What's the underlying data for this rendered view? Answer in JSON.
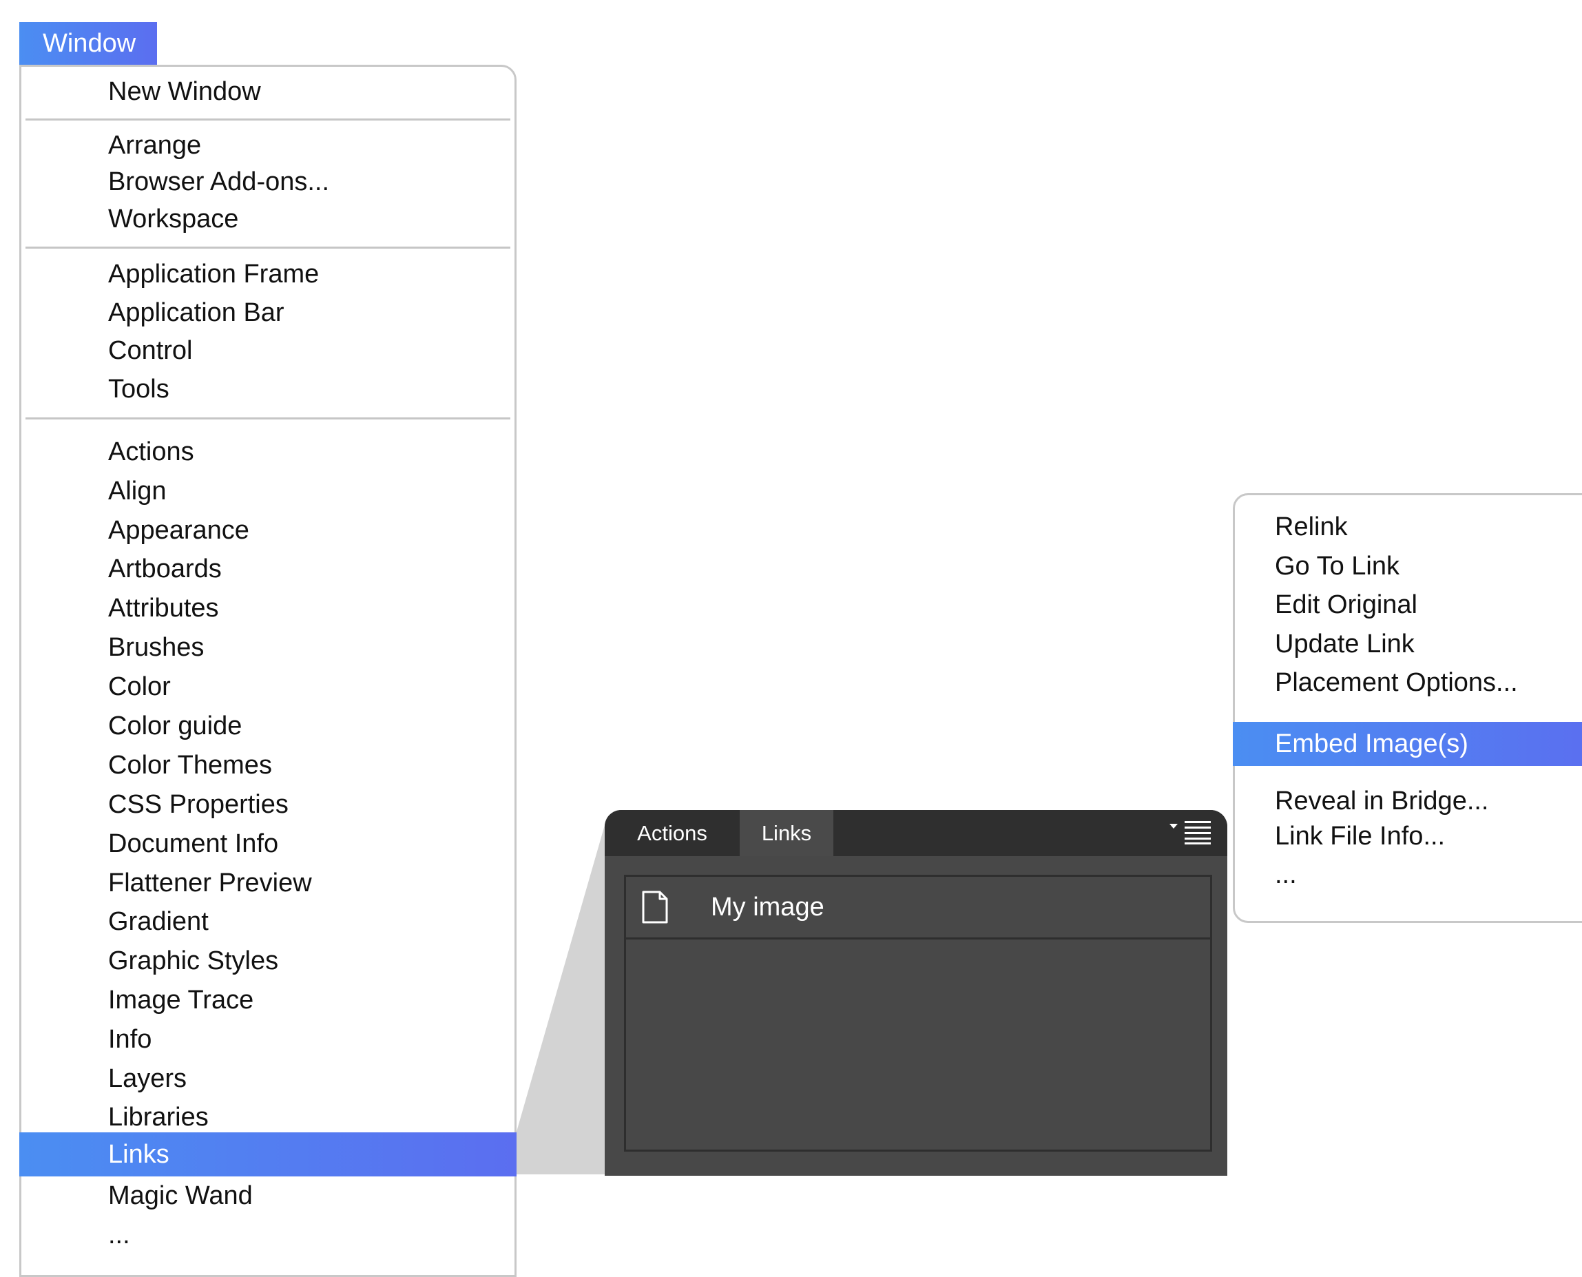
{
  "window_menu": {
    "title": "Window",
    "groups": [
      [
        "New Window"
      ],
      [
        "Arrange",
        "Browser Add-ons...",
        "Workspace"
      ],
      [
        "Application Frame",
        "Application Bar",
        "Control",
        "Tools"
      ],
      [
        "Actions",
        "Align",
        "Appearance",
        "Artboards",
        "Attributes",
        "Brushes",
        "Color",
        "Color guide",
        "Color Themes",
        "CSS Properties",
        "Document Info",
        "Flattener Preview",
        "Gradient",
        "Graphic Styles",
        "Image Trace",
        "Info",
        "Layers",
        "Libraries",
        "Links",
        "Magic Wand",
        "..."
      ]
    ],
    "selected": "Links"
  },
  "panel": {
    "tabs": [
      "Actions",
      "Links"
    ],
    "active_tab": "Links",
    "items": [
      {
        "name": "My image",
        "icon": "document-icon"
      }
    ],
    "menu_icon": "panel-menu-icon"
  },
  "context_menu": {
    "groups": [
      [
        "Relink",
        "Go To Link",
        "Edit Original",
        "Update Link",
        "Placement Options..."
      ],
      [
        "Embed Image(s)"
      ],
      [
        "Reveal in Bridge...",
        "Link File Info...",
        "..."
      ]
    ],
    "selected": "Embed Image(s)"
  },
  "colors": {
    "highlight": "#4b8ef2",
    "highlight_end": "#5b6ef0",
    "panel_bg": "#484848",
    "panel_tabbar": "#2f2f2f",
    "wedge": "#d3d3d3"
  }
}
